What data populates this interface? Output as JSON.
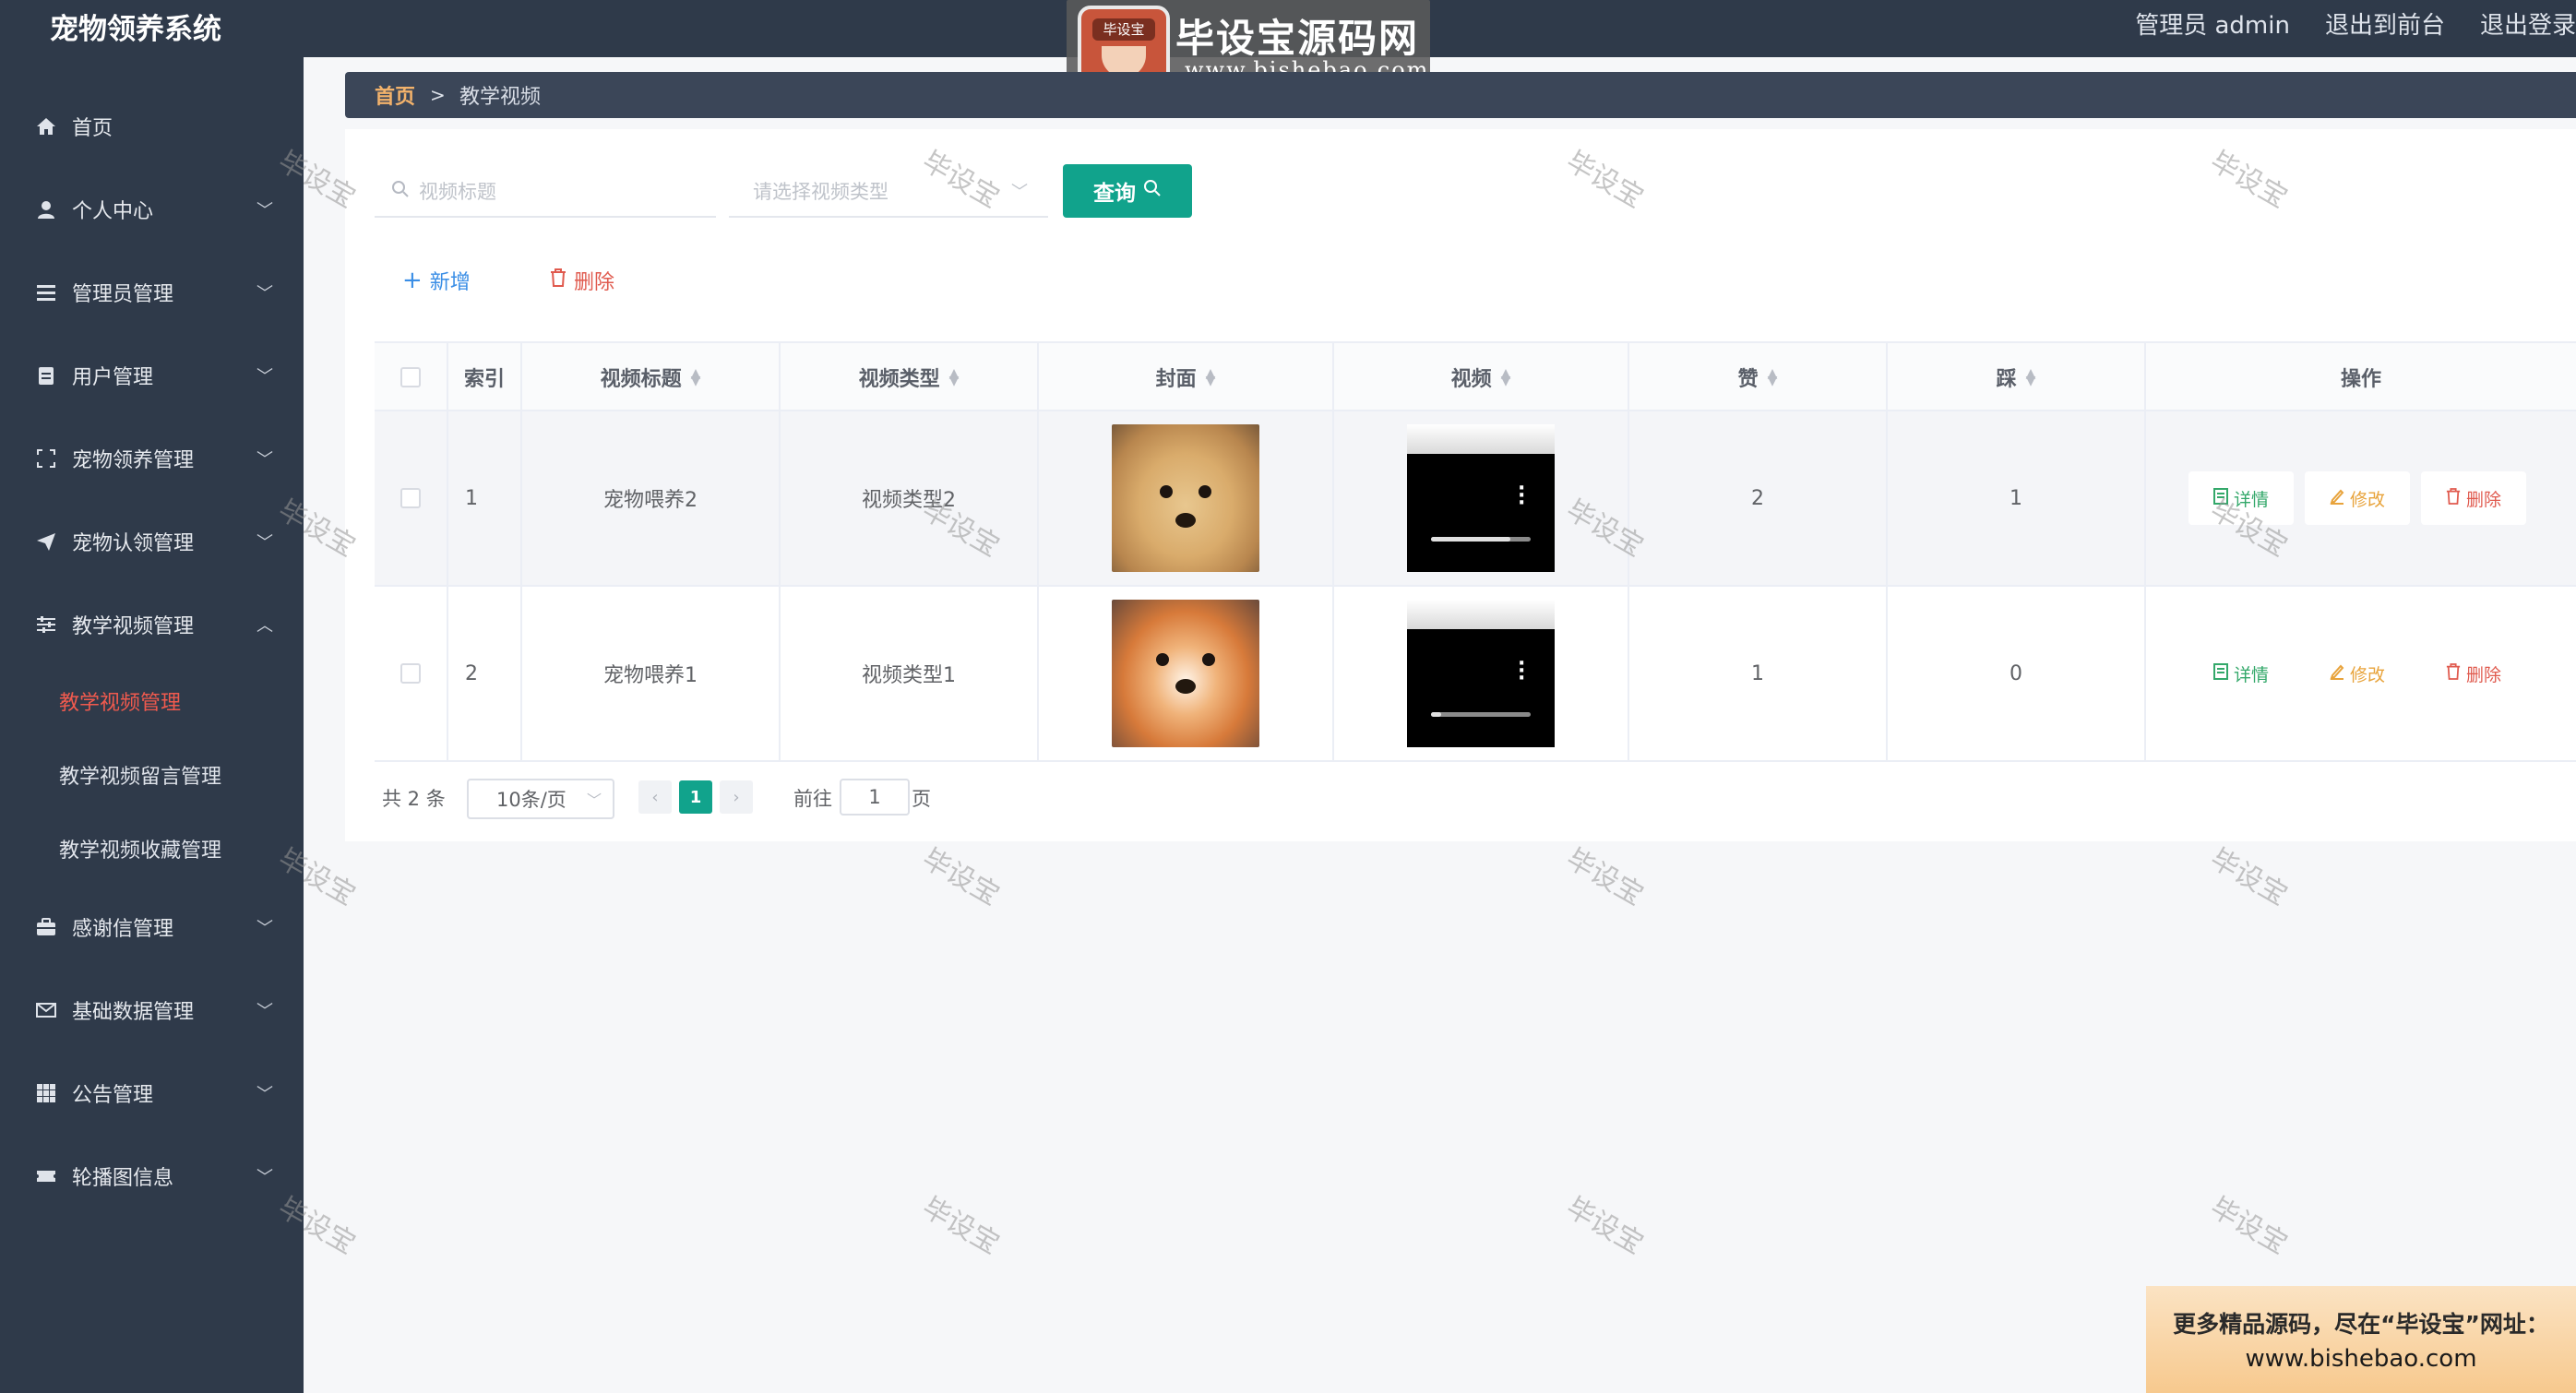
{
  "app": {
    "title": "宠物领养系统"
  },
  "header": {
    "admin_label": "管理员 admin",
    "to_frontend": "退出到前台",
    "logout": "退出登录"
  },
  "logo": {
    "emblem_text": "毕设宝",
    "name": "毕设宝源码网",
    "url": "www.bishebao.com"
  },
  "sidebar": {
    "items": [
      {
        "label": "首页",
        "icon": "home-icon"
      },
      {
        "label": "个人中心",
        "icon": "user-icon"
      },
      {
        "label": "管理员管理",
        "icon": "list-icon"
      },
      {
        "label": "用户管理",
        "icon": "clipboard-icon"
      },
      {
        "label": "宠物领养管理",
        "icon": "frame-icon"
      },
      {
        "label": "宠物认领管理",
        "icon": "send-icon"
      },
      {
        "label": "教学视频管理",
        "icon": "sliders-icon"
      },
      {
        "label": "感谢信管理",
        "icon": "briefcase-icon"
      },
      {
        "label": "基础数据管理",
        "icon": "mail-icon"
      },
      {
        "label": "公告管理",
        "icon": "grid-icon"
      },
      {
        "label": "轮播图信息",
        "icon": "ticket-icon"
      }
    ],
    "sub_items": [
      "教学视频管理",
      "教学视频留言管理",
      "教学视频收藏管理"
    ]
  },
  "breadcrumb": {
    "home": "首页",
    "sep": ">",
    "current": "教学视频"
  },
  "search": {
    "title_placeholder": "视频标题",
    "type_placeholder": "请选择视频类型",
    "query_label": "查询"
  },
  "actions": {
    "add_label": "新增",
    "delete_label": "删除"
  },
  "table": {
    "headers": [
      "索引",
      "视频标题",
      "视频类型",
      "封面",
      "视频",
      "赞",
      "踩",
      "操作"
    ],
    "rows": [
      {
        "index": "1",
        "title": "宠物喂养2",
        "type": "视频类型2",
        "likes": "2",
        "dislikes": "1",
        "progress": 0.8
      },
      {
        "index": "2",
        "title": "宠物喂养1",
        "type": "视频类型1",
        "likes": "1",
        "dislikes": "0",
        "progress": 0.1
      }
    ],
    "op_labels": {
      "detail": "详情",
      "edit": "修改",
      "delete": "删除"
    }
  },
  "pagination": {
    "total": "共 2 条",
    "page_size": "10条/页",
    "current_page": "1",
    "goto_label": "前往",
    "goto_value": "1",
    "goto_unit": "页"
  },
  "watermark": {
    "text": "毕设宝"
  },
  "banner": {
    "line1": "更多精品源码，尽在“毕设宝”网址：",
    "line2": "www.bishebao.com"
  },
  "colors": {
    "sidebar_bg": "#2f3a4a",
    "accent": "#11a38c",
    "active_nav": "#f05a4e",
    "danger": "#e05a4e",
    "warning": "#e8a33b",
    "success": "#33a86a"
  }
}
